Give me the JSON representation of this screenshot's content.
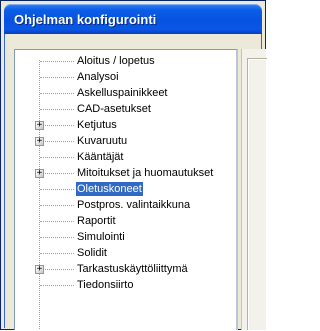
{
  "window": {
    "title": "Ohjelman konfigurointi"
  },
  "tree": {
    "items": [
      {
        "label": "Aloitus / lopetus",
        "expandable": false,
        "selected": false
      },
      {
        "label": "Analysoi",
        "expandable": false,
        "selected": false
      },
      {
        "label": "Askelluspainikkeet",
        "expandable": false,
        "selected": false
      },
      {
        "label": "CAD-asetukset",
        "expandable": false,
        "selected": false
      },
      {
        "label": "Ketjutus",
        "expandable": true,
        "selected": false
      },
      {
        "label": "Kuvaruutu",
        "expandable": true,
        "selected": false
      },
      {
        "label": "Kääntäjät",
        "expandable": false,
        "selected": false
      },
      {
        "label": "Mitoitukset ja huomautukset",
        "expandable": true,
        "selected": false
      },
      {
        "label": "Oletuskoneet",
        "expandable": false,
        "selected": true
      },
      {
        "label": "Postpros. valintaikkuna",
        "expandable": false,
        "selected": false
      },
      {
        "label": "Raportit",
        "expandable": false,
        "selected": false
      },
      {
        "label": "Simulointi",
        "expandable": false,
        "selected": false
      },
      {
        "label": "Solidit",
        "expandable": false,
        "selected": false
      },
      {
        "label": "Tarkastuskäyttöliittymä",
        "expandable": true,
        "selected": false
      },
      {
        "label": "Tiedonsiirto",
        "expandable": false,
        "selected": false
      }
    ],
    "expander_glyph": "+"
  },
  "colors": {
    "titlebar": "#0752e0",
    "selection": "#316ac5",
    "window_bg": "#ece9d8"
  }
}
